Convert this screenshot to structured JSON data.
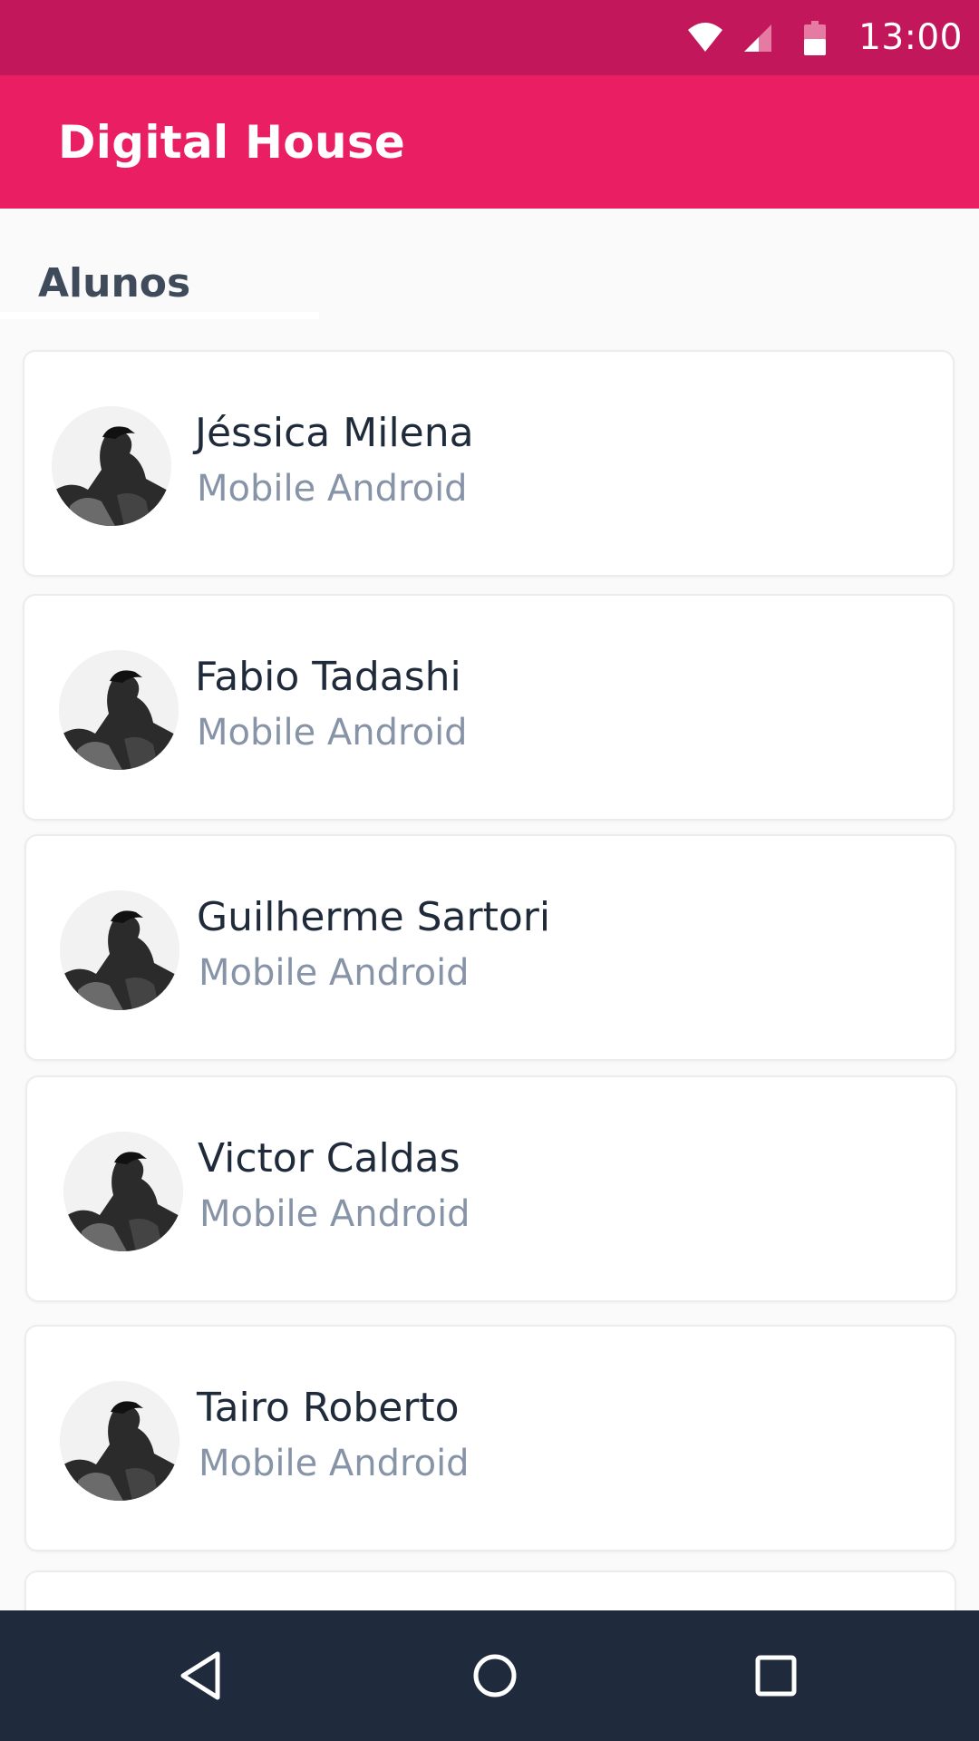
{
  "status_bar": {
    "time": "13:00",
    "icons": [
      "wifi-icon",
      "cellular-signal-icon",
      "battery-icon"
    ]
  },
  "app_bar": {
    "title": "Digital House"
  },
  "section": {
    "title": "Alunos"
  },
  "students": [
    {
      "name": "Jéssica Milena",
      "course": "Mobile Android"
    },
    {
      "name": "Fabio Tadashi",
      "course": "Mobile Android"
    },
    {
      "name": "Guilherme Sartori",
      "course": "Mobile Android"
    },
    {
      "name": "Victor Caldas",
      "course": "Mobile Android"
    },
    {
      "name": "Tairo Roberto",
      "course": "Mobile Android"
    }
  ],
  "nav_bar": {
    "buttons": [
      "back-icon",
      "home-icon",
      "recents-icon"
    ]
  },
  "colors": {
    "status_bar": "#c2185b",
    "app_bar": "#e91e63",
    "nav_bar": "#1f2b3c",
    "name_text": "#1f2a3a",
    "course_text": "#8794a8"
  }
}
